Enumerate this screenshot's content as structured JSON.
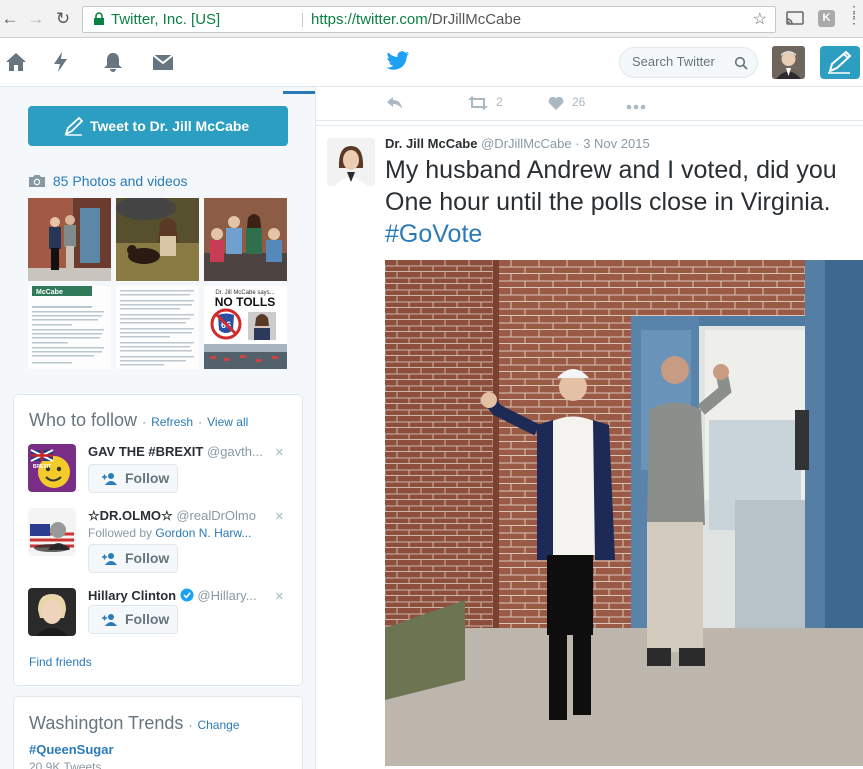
{
  "browser": {
    "secure_label": "Twitter, Inc. [US]",
    "url_host": "https://twitter.com",
    "url_path": "/DrJillMcCabe"
  },
  "nav": {
    "search_placeholder": "Search Twitter"
  },
  "sidebar": {
    "tweet_to_label": "Tweet to Dr. Jill McCabe",
    "photos_label": "85 Photos and videos",
    "thumb_text": {
      "nyt_header": "McCabe",
      "no_tolls_title": "Dr. Jill McCabe says...",
      "no_tolls_text": "NO TOLLS",
      "shield_number": "66"
    }
  },
  "who_to_follow": {
    "title": "Who to follow",
    "refresh": "Refresh",
    "view_all": "View all",
    "separator": "·",
    "follow_label": "Follow",
    "close": "×",
    "items": [
      {
        "name": "GAV THE #BREXIT",
        "handle": "@gavth...",
        "followed_by_prefix": "",
        "followed_by_name": "",
        "badge": "BREXIT"
      },
      {
        "name": "☆DR.OLMO☆",
        "handle": "@realDrOlmo",
        "followed_by_prefix": "Followed by",
        "followed_by_name": "Gordon N. Harw..."
      },
      {
        "name": "Hillary Clinton",
        "handle": "@Hillary...",
        "followed_by_prefix": "",
        "followed_by_name": ""
      }
    ],
    "find_friends": "Find friends"
  },
  "trends": {
    "title": "Washington Trends",
    "change": "Change",
    "separator": "·",
    "top_tag": "#QueenSugar",
    "top_count": "20.9K Tweets"
  },
  "main": {
    "prev_tweet_actions": {
      "retweets": "2",
      "likes": "26"
    },
    "tweet": {
      "name": "Dr. Jill McCabe",
      "handle": "@DrJillMcCabe",
      "date": "3 Nov 2015",
      "separator": "·",
      "line1": "My husband Andrew and I voted, did you",
      "line2": "One hour until the polls close in Virginia.",
      "hashtag": "#GoVote"
    }
  },
  "colors": {
    "twitter_blue": "#2b9ec1",
    "link_blue": "#2b7bb9",
    "secure_green": "#0b8043"
  }
}
